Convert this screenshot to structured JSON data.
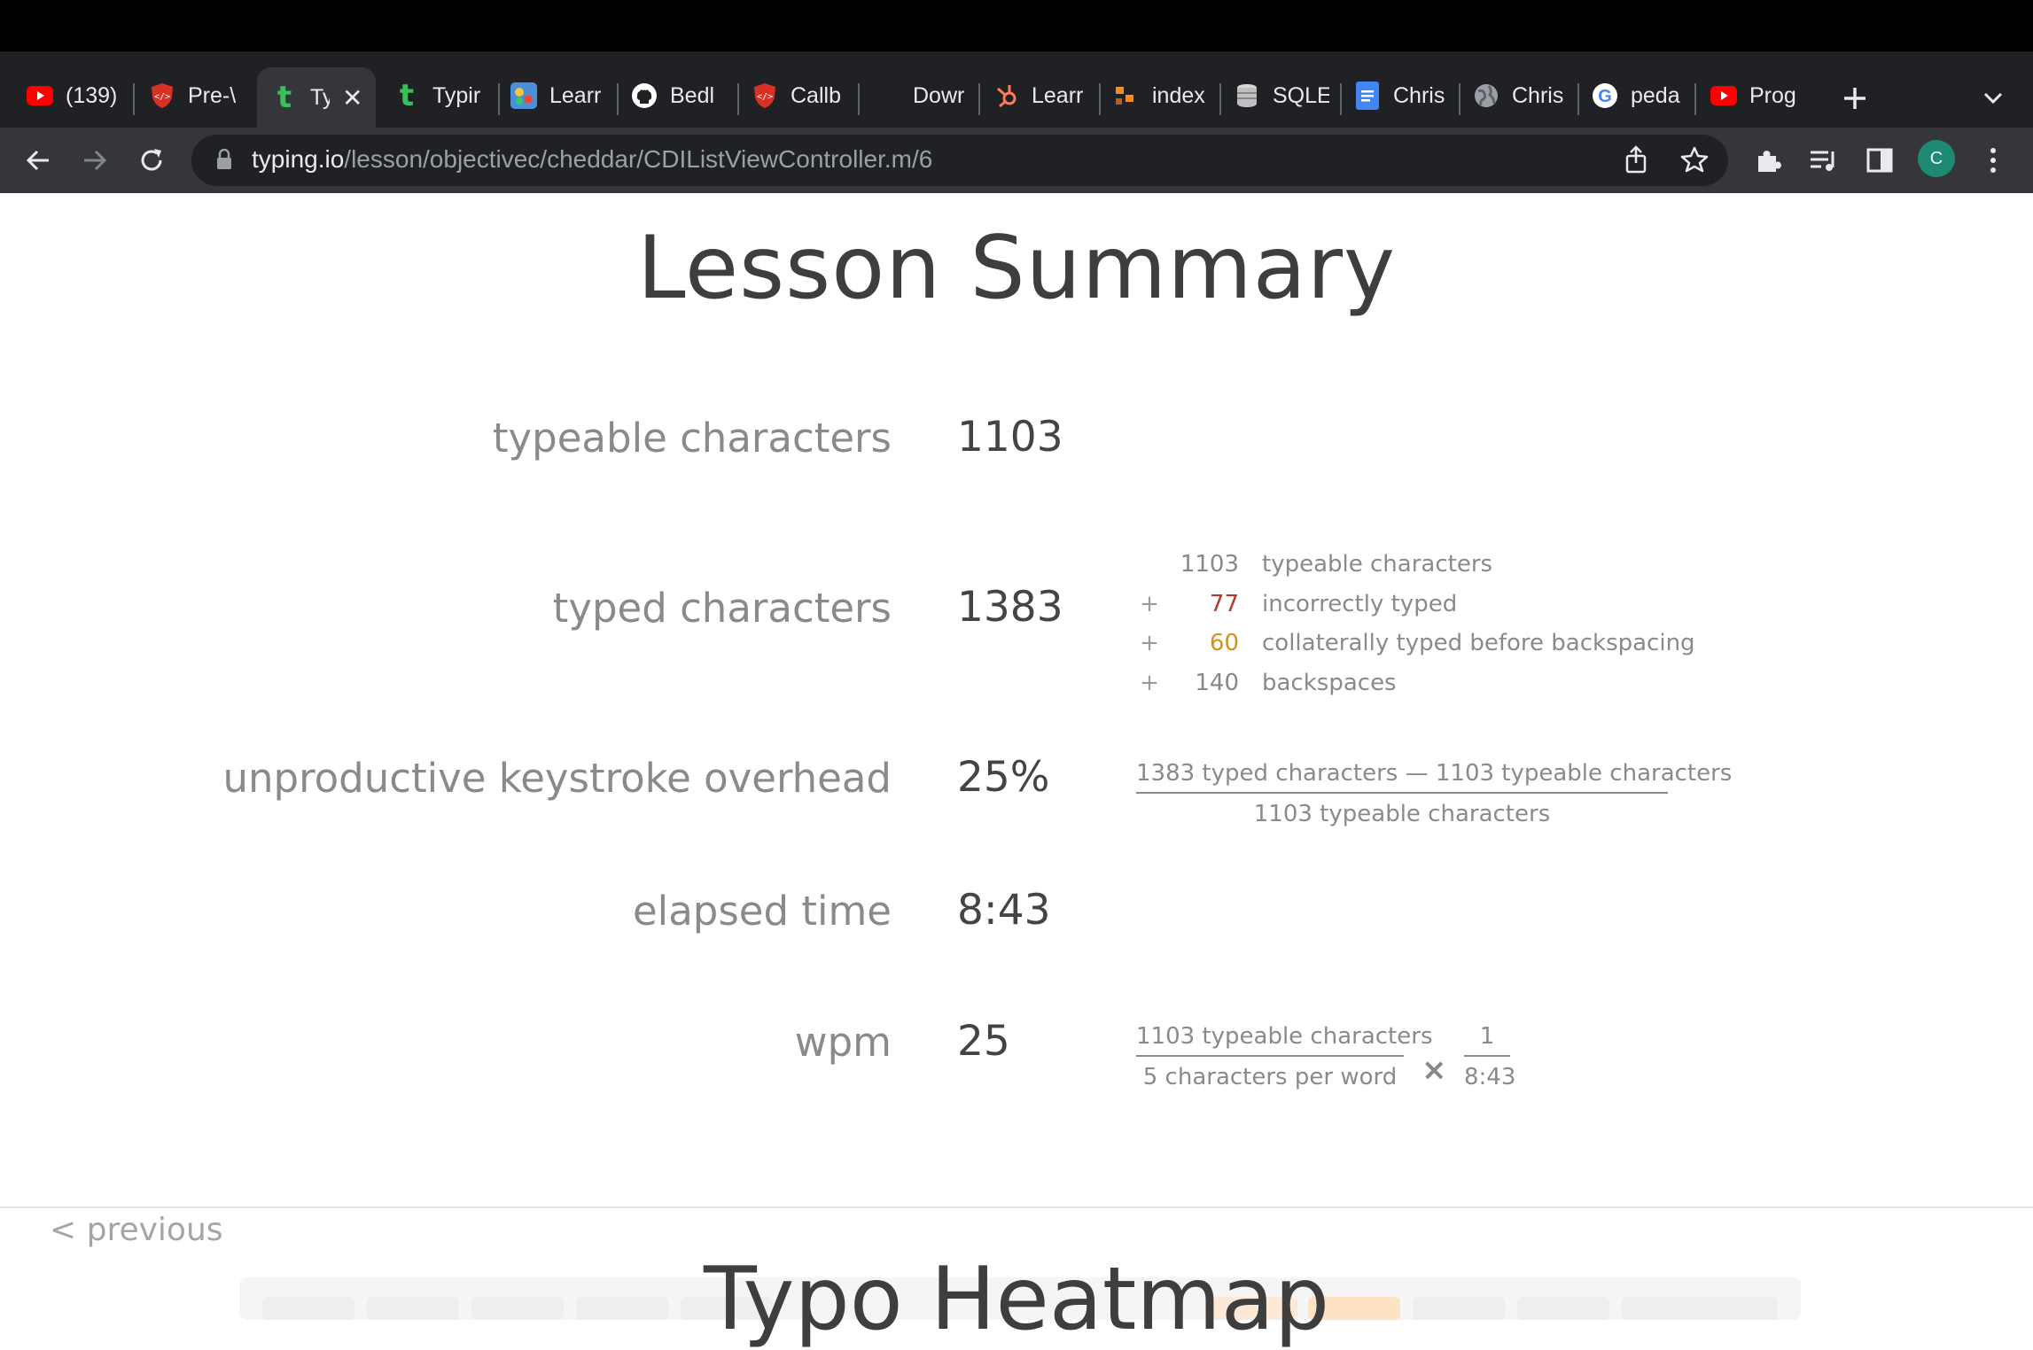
{
  "browser": {
    "tabs": [
      {
        "label": "(139)",
        "icon": "youtube-icon"
      },
      {
        "label": "Pre-\\",
        "icon": "shield-code-icon"
      },
      {
        "label": "Ty",
        "icon": "typing-t-icon",
        "active": true
      },
      {
        "label": "Typir",
        "icon": "typing-t-icon"
      },
      {
        "label": "Learr",
        "icon": "puzzle-app-icon"
      },
      {
        "label": "Bedl",
        "icon": "github-icon"
      },
      {
        "label": "Callb",
        "icon": "shield-code-icon"
      },
      {
        "label": "Dowr",
        "icon": "blank-icon"
      },
      {
        "label": "Learr",
        "icon": "hubspot-icon"
      },
      {
        "label": "index",
        "icon": "orange-blocks-icon"
      },
      {
        "label": "SQLE",
        "icon": "database-icon"
      },
      {
        "label": "Chris",
        "icon": "docs-icon"
      },
      {
        "label": "Chris",
        "icon": "globe-icon"
      },
      {
        "label": "peda",
        "icon": "google-icon"
      },
      {
        "label": "Prog",
        "icon": "youtube-icon"
      }
    ],
    "url_host": "typing.io",
    "url_path": "/lesson/objectivec/cheddar/CDIListViewController.m/6",
    "avatar_letter": "C"
  },
  "page": {
    "title": "Lesson Summary",
    "stats": {
      "typeable": {
        "label": "typeable characters",
        "value": "1103"
      },
      "typed": {
        "label": "typed characters",
        "value": "1383"
      },
      "overhead": {
        "label": "unproductive keystroke overhead",
        "value": "25%"
      },
      "elapsed": {
        "label": "elapsed time",
        "value": "8:43"
      },
      "wpm": {
        "label": "wpm",
        "value": "25"
      }
    },
    "typed_breakdown": [
      {
        "op": "",
        "num": "1103",
        "text": "typeable characters",
        "color": "#888888"
      },
      {
        "op": "+",
        "num": "77",
        "text": "incorrectly typed",
        "color": "#b03a2e"
      },
      {
        "op": "+",
        "num": "60",
        "text": "collaterally typed before backspacing",
        "color": "#d4911c"
      },
      {
        "op": "+",
        "num": "140",
        "text": "backspaces",
        "color": "#888888"
      }
    ],
    "overhead_formula": {
      "numerator": "1383 typed characters — 1103 typeable characters",
      "denominator": "1103 typeable characters"
    },
    "wpm_formula": {
      "frac1_num": "1103 typeable characters",
      "frac1_den": "5 characters per word",
      "times": "×",
      "frac2_num": "1",
      "frac2_den": "8:43"
    },
    "previous_link": "< previous",
    "heatmap_title": "Typo Heatmap"
  }
}
